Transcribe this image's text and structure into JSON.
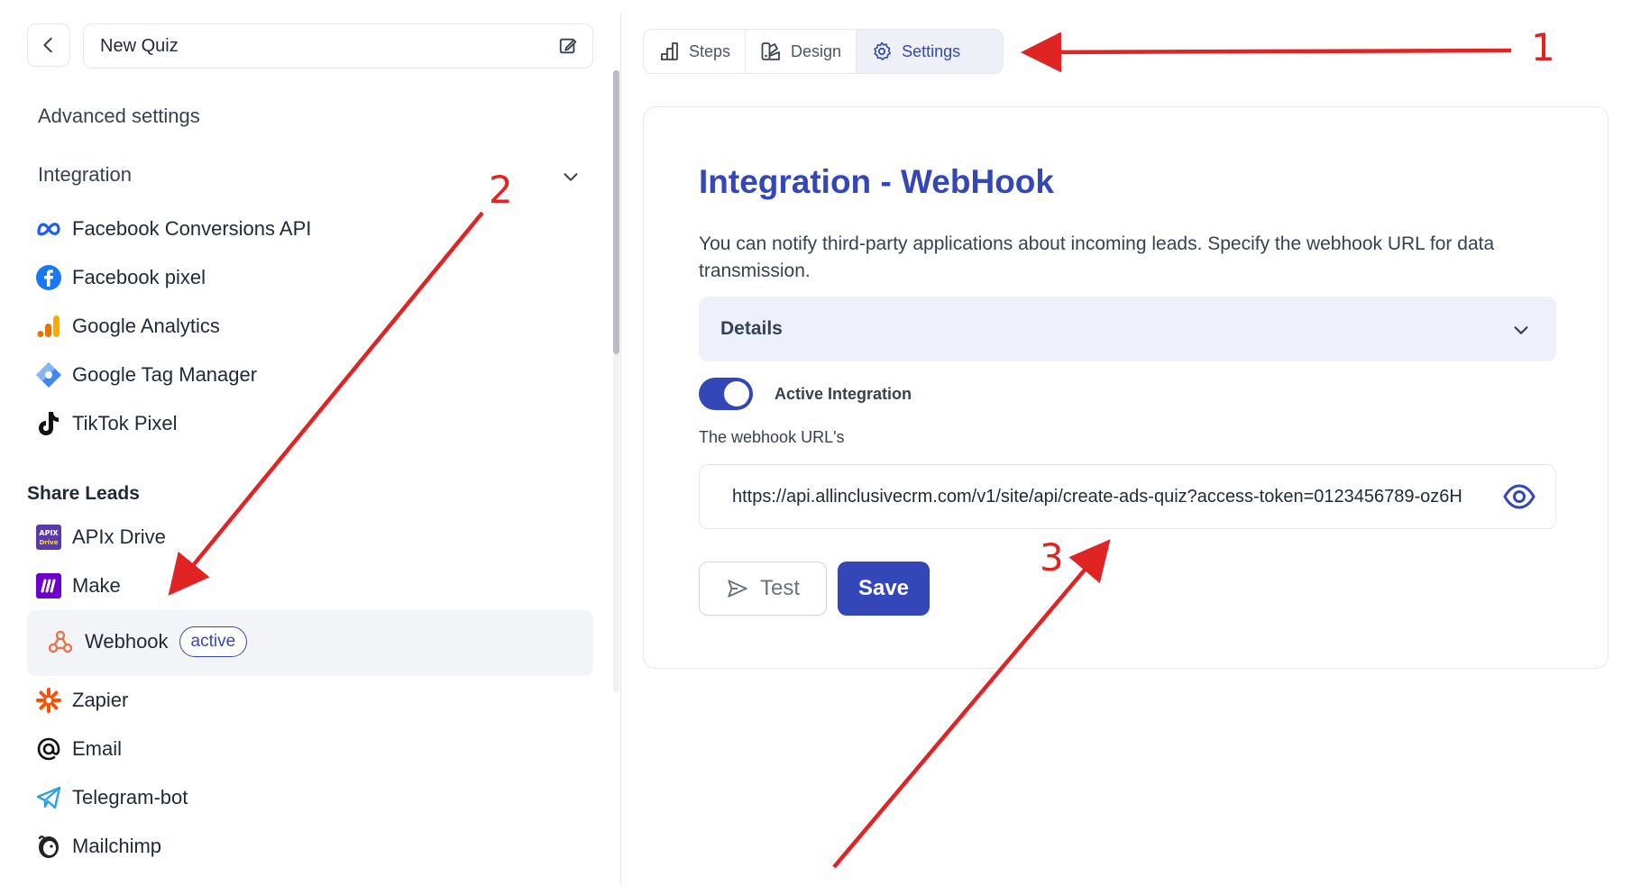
{
  "header": {
    "quiz_name": "New Quiz"
  },
  "sidebar": {
    "advanced_title": "Advanced settings",
    "integration_label": "Integration",
    "integrations": [
      {
        "label": "Facebook Conversions API",
        "icon": "meta-icon"
      },
      {
        "label": "Facebook pixel",
        "icon": "facebook-icon"
      },
      {
        "label": "Google Analytics",
        "icon": "google-analytics-icon"
      },
      {
        "label": "Google Tag Manager",
        "icon": "google-tag-manager-icon"
      },
      {
        "label": "TikTok Pixel",
        "icon": "tiktok-icon"
      }
    ],
    "share_title": "Share Leads",
    "share": [
      {
        "label": "APIx Drive",
        "icon": "apix-drive-icon"
      },
      {
        "label": "Make",
        "icon": "make-icon"
      },
      {
        "label": "Webhook",
        "icon": "webhook-icon",
        "badge": "active"
      },
      {
        "label": "Zapier",
        "icon": "zapier-icon"
      },
      {
        "label": "Email",
        "icon": "at-icon"
      },
      {
        "label": "Telegram-bot",
        "icon": "telegram-icon"
      },
      {
        "label": "Mailchimp",
        "icon": "mailchimp-icon"
      }
    ]
  },
  "tabs": [
    {
      "label": "Steps",
      "icon": "steps-icon"
    },
    {
      "label": "Design",
      "icon": "palette-icon"
    },
    {
      "label": "Settings",
      "icon": "gear-icon",
      "active": true
    }
  ],
  "main": {
    "title": "Integration - WebHook",
    "description": "You can notify third-party applications about incoming leads. Specify the webhook URL for data transmission.",
    "details_label": "Details",
    "active_label": "Active Integration",
    "active": true,
    "url_label": "The webhook URL's",
    "url_value": "https://api.allinclusivecrm.com/v1/site/api/create-ads-quiz?access-token=0123456789-oz6H",
    "test_label": "Test",
    "save_label": "Save"
  },
  "annotations": [
    "1",
    "2",
    "3"
  ],
  "colors": {
    "accent": "#3347b8",
    "annotation": "#e02424"
  }
}
